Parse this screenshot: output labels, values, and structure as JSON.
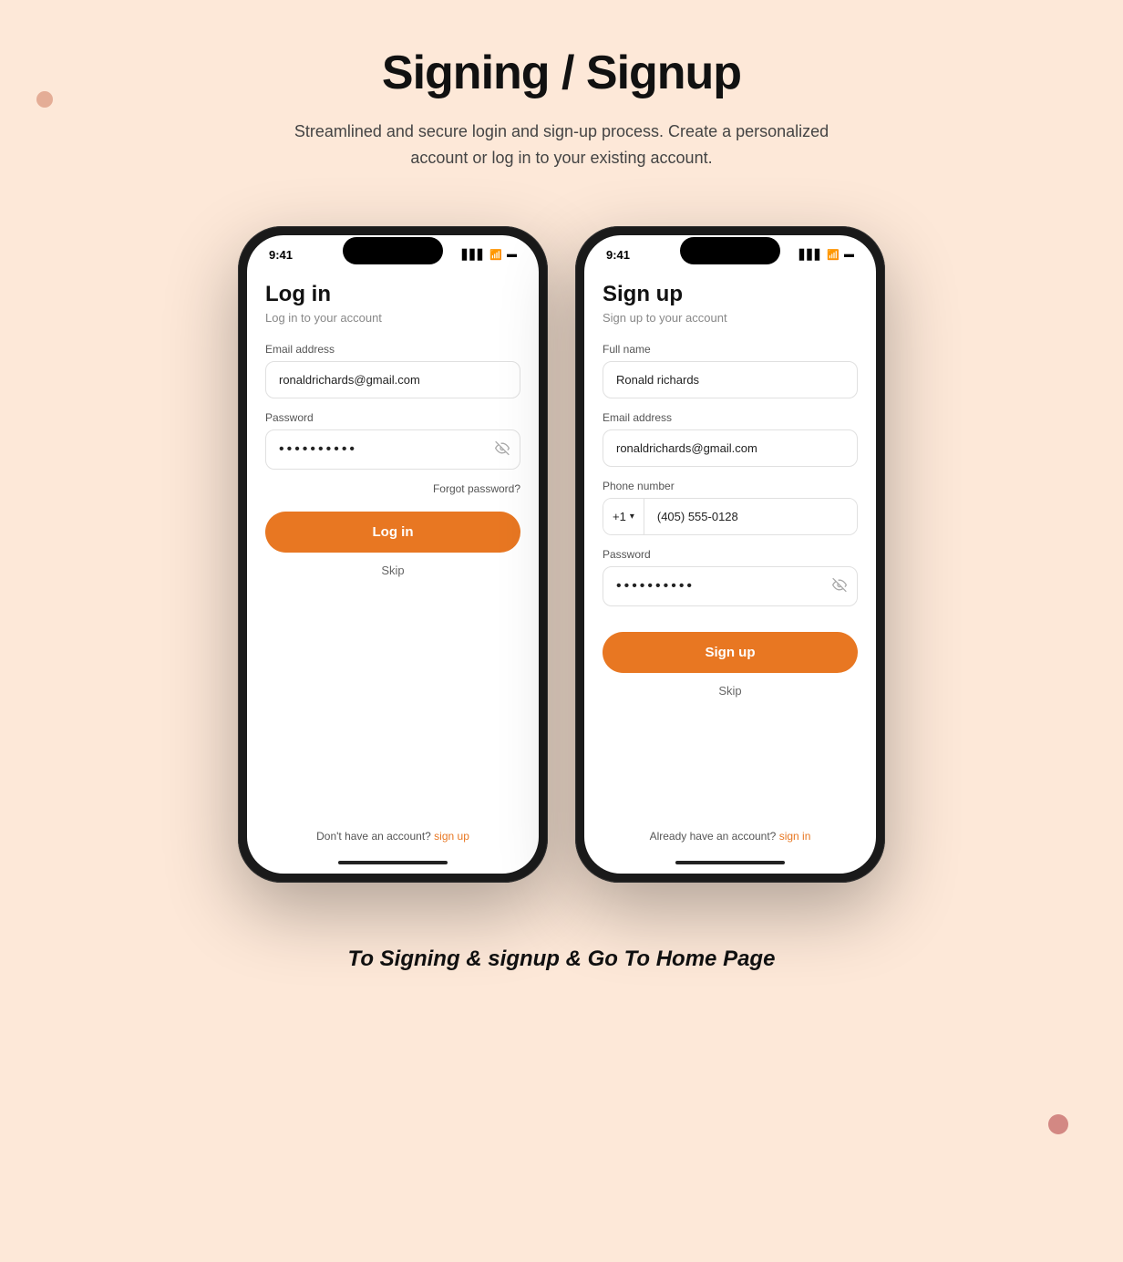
{
  "page": {
    "title": "Signing / Signup",
    "subtitle": "Streamlined and secure login and sign-up process. Create a personalized account or log in to your existing account.",
    "bottom_caption": "To Signing & signup & Go To Home Page"
  },
  "login_screen": {
    "status_time": "9:41",
    "title": "Log in",
    "subtitle": "Log in to your account",
    "email_label": "Email address",
    "email_value": "ronaldrichards@gmail.com",
    "password_label": "Password",
    "password_value": "••••••••••",
    "forgot_password": "Forgot password?",
    "login_button": "Log in",
    "skip_label": "Skip",
    "footer_text": "Don't have an account?",
    "footer_link": "sign up"
  },
  "signup_screen": {
    "status_time": "9:41",
    "title": "Sign up",
    "subtitle": "Sign up to your account",
    "fullname_label": "Full name",
    "fullname_value": "Ronald richards",
    "email_label": "Email address",
    "email_value": "ronaldrichards@gmail.com",
    "phone_label": "Phone number",
    "country_code": "+1",
    "phone_value": "(405) 555-0128",
    "password_label": "Password",
    "password_value": "••••••••••",
    "signup_button": "Sign up",
    "skip_label": "Skip",
    "footer_text": "Already have an account?",
    "footer_link": "sign in"
  },
  "colors": {
    "accent": "#e87722",
    "background": "#fde8d8",
    "text_dark": "#111111",
    "text_medium": "#555555",
    "text_light": "#888888",
    "border": "#e0e0e0"
  }
}
